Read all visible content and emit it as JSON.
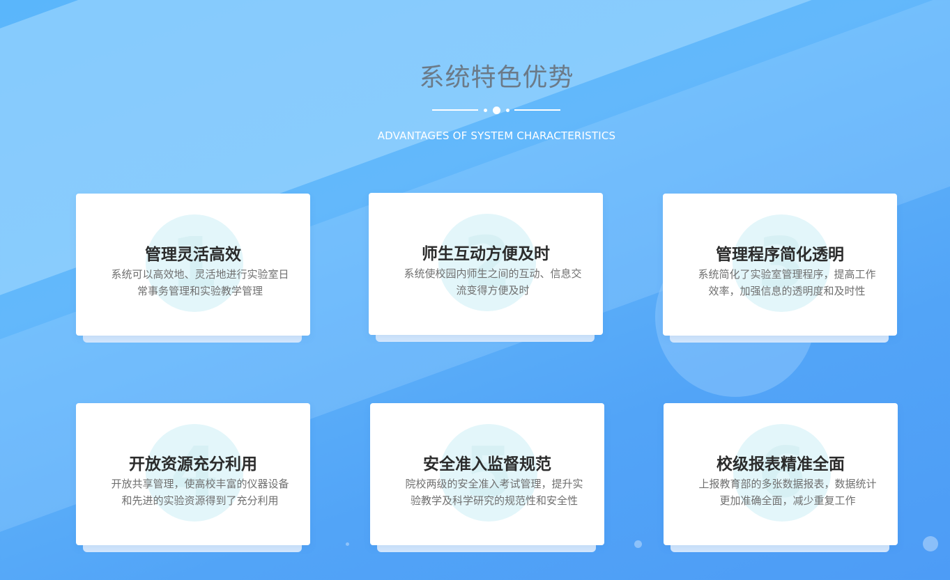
{
  "header": {
    "title": "系统特色优势",
    "subtitle": "ADVANTAGES OF SYSTEM CHARACTERISTICS"
  },
  "cards": [
    {
      "number": "1",
      "title": "管理灵活高效",
      "desc": "系统可以高效地、灵活地进行实验室日常事务管理和实验教学管理"
    },
    {
      "number": "2",
      "title": "师生互动方便及时",
      "desc": "系统使校园内师生之间的互动、信息交流变得方便及时"
    },
    {
      "number": "3",
      "title": "管理程序简化透明",
      "desc": "系统简化了实验室管理程序，提高工作效率，加强信息的透明度和及时性"
    },
    {
      "number": "4",
      "title": "开放资源充分利用",
      "desc": "开放共享管理，使高校丰富的仪器设备和先进的实验资源得到了充分利用"
    },
    {
      "number": "5",
      "title": "安全准入监督规范",
      "desc": "院校两级的安全准入考试管理，提升实验教学及科学研究的规范性和安全性"
    },
    {
      "number": "6",
      "title": "校级报表精准全面",
      "desc": "上报教育部的多张数据报表，数据统计更加准确全面，减少重复工作"
    }
  ],
  "colors": {
    "background": "#5ab6fb",
    "title": "#6b7a88",
    "card_title": "#2b2b2b",
    "card_desc": "#6f6f6f"
  }
}
